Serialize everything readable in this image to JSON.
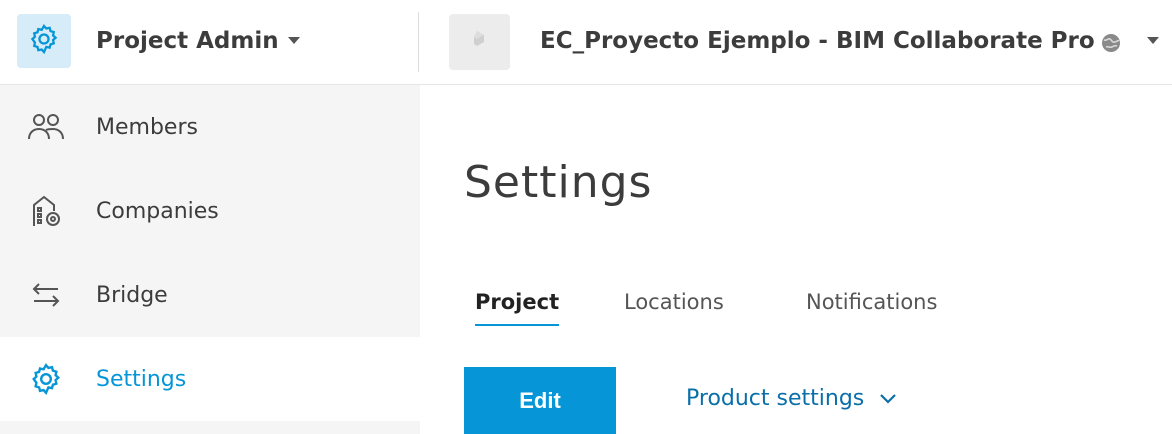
{
  "header": {
    "module_label": "Project Admin",
    "project_name": "EC_Proyecto Ejemplo - BIM Collaborate Pro",
    "module_icon": "gear-icon",
    "project_icon": "project-thumbnail-icon",
    "status_icon": "globe-icon"
  },
  "sidebar": {
    "items": [
      {
        "label": "Members",
        "icon": "members-icon"
      },
      {
        "label": "Companies",
        "icon": "companies-icon"
      },
      {
        "label": "Bridge",
        "icon": "bridge-icon"
      },
      {
        "label": "Settings",
        "icon": "gear-icon",
        "active": true
      }
    ]
  },
  "main": {
    "title": "Settings",
    "tabs": [
      {
        "label": "Project",
        "active": true
      },
      {
        "label": "Locations"
      },
      {
        "label": "Notifications"
      }
    ],
    "edit_button": "Edit",
    "product_settings": "Product settings"
  },
  "colors": {
    "accent": "#0696d7",
    "sidebar_bg": "#f5f5f5"
  }
}
